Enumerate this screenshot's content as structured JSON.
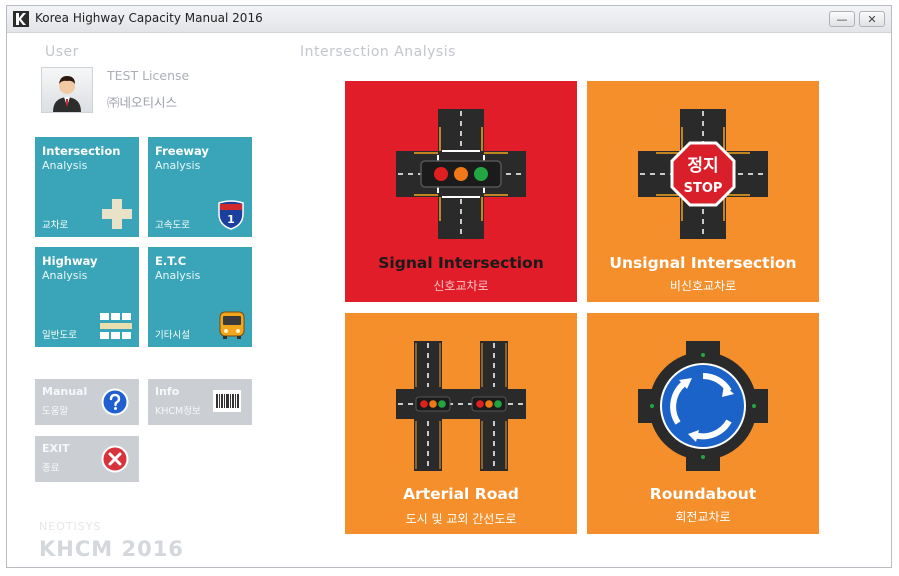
{
  "window": {
    "title": "Korea Highway Capacity Manual 2016",
    "minimize": "—",
    "close": "✕"
  },
  "user": {
    "section_label": "User",
    "name": "TEST License",
    "org": "㈜네오티시스"
  },
  "left_tiles": [
    {
      "title": "Intersection",
      "sub": "Analysis",
      "kor": "교차로",
      "icon": "plus-cross-icon"
    },
    {
      "title": "Freeway",
      "sub": "Analysis",
      "kor": "고속도로",
      "badge": "1",
      "icon": "highway-shield-icon"
    },
    {
      "title": "Highway",
      "sub": "Analysis",
      "kor": "일반도로",
      "icon": "road-blocks-icon"
    },
    {
      "title": "E.T.C",
      "sub": "Analysis",
      "kor": "기타시설",
      "icon": "bus-icon"
    }
  ],
  "util_tiles": [
    {
      "title": "Manual",
      "sub": "도움말",
      "icon": "help-icon"
    },
    {
      "title": "Info",
      "sub": "KHCM정보",
      "icon": "barcode-icon"
    },
    {
      "title": "EXIT",
      "sub": "종료",
      "icon": "close-circle-icon"
    }
  ],
  "main": {
    "section_label": "Intersection Analysis",
    "tiles": [
      {
        "title": "Signal Intersection",
        "sub": "신호교차로",
        "color": "#e11d2a"
      },
      {
        "title": "Unsignal Intersection",
        "sub": "비신호교차로",
        "color": "#f58f2c",
        "sign_top": "정지",
        "sign_bottom": "STOP"
      },
      {
        "title": "Arterial Road",
        "sub": "도시 및 교외 간선도로",
        "color": "#f58f2c"
      },
      {
        "title": "Roundabout",
        "sub": "회전교차로",
        "color": "#f58f2c"
      }
    ]
  },
  "brand": {
    "small": "NEOTISYS",
    "big": "KHCM 2016"
  }
}
